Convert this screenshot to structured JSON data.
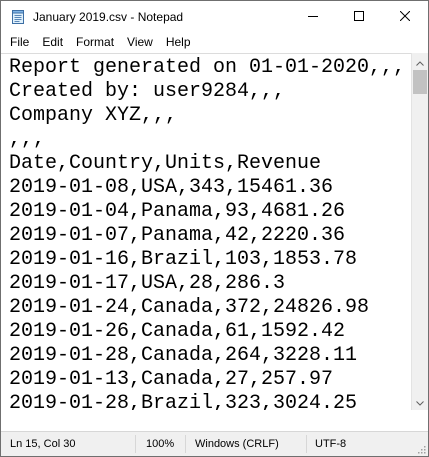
{
  "window": {
    "title": "January 2019.csv - Notepad"
  },
  "icons": {
    "app": "notepad-icon",
    "minimize": "minimize-icon",
    "maximize": "maximize-icon",
    "close": "close-icon"
  },
  "menu": {
    "items": [
      "File",
      "Edit",
      "Format",
      "View",
      "Help"
    ]
  },
  "editor": {
    "lines": [
      "Report generated on 01-01-2020,,,",
      "Created by: user9284,,,",
      "Company XYZ,,,",
      ",,,",
      "Date,Country,Units,Revenue",
      "2019-01-08,USA,343,15461.36",
      "2019-01-04,Panama,93,4681.26",
      "2019-01-07,Panama,42,2220.36",
      "2019-01-16,Brazil,103,1853.78",
      "2019-01-17,USA,28,286.3",
      "2019-01-24,Canada,372,24826.98",
      "2019-01-26,Canada,61,1592.42",
      "2019-01-28,Canada,264,3228.11",
      "2019-01-13,Canada,27,257.97",
      "2019-01-28,Brazil,323,3024.25"
    ]
  },
  "status": {
    "position": "Ln 15, Col 30",
    "zoom": "100%",
    "line_ending": "Windows (CRLF)",
    "encoding": "UTF-8"
  },
  "colors": {
    "text": "#000000",
    "background": "#ffffff",
    "chrome": "#f0f0f0",
    "scroll_thumb": "#c2c2c2"
  }
}
